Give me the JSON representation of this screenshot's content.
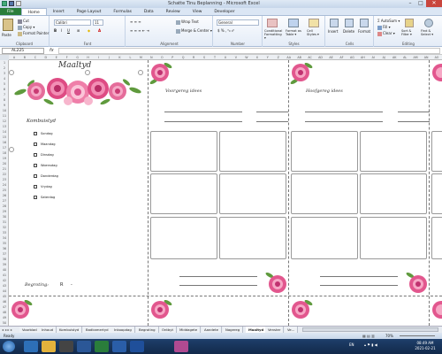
{
  "window": {
    "title": "Schatte Tinu Beplanning  -  Microsoft Excel"
  },
  "tabs": [
    "File",
    "Home",
    "Insert",
    "Page Layout",
    "Formulas",
    "Data",
    "Review",
    "View",
    "Developer"
  ],
  "ribbon": {
    "clipboard": {
      "paste": "Paste",
      "cut": "Cut",
      "copy": "Copy ▾",
      "format_painter": "Format Painter",
      "label": "Clipboard"
    },
    "font": {
      "name": "Calibri",
      "size": "11",
      "label": "Font"
    },
    "alignment": {
      "wrap": "Wrap Text",
      "merge": "Merge & Center ▾",
      "label": "Alignment"
    },
    "number": {
      "format": "General",
      "label": "Number"
    },
    "styles": {
      "conditional": "Conditional Formatting ▾",
      "format_table": "Format as Table ▾",
      "cell_styles": "Cell Styles ▾",
      "label": "Styles"
    },
    "cells": {
      "insert": "Insert",
      "delete": "Delete",
      "format": "Format",
      "label": "Cells"
    },
    "editing": {
      "autosum": "AutoSum ▾",
      "fill": "Fill ▾",
      "clear": "Clear ▾",
      "sort": "Sort & Filter ▾",
      "find": "Find & Select ▾",
      "label": "Editing"
    }
  },
  "formula_bar": {
    "name_box": "AL225",
    "fx": "fx"
  },
  "columns": [
    "A",
    "B",
    "C",
    "D",
    "E",
    "F",
    "G",
    "H",
    "I",
    "J",
    "K",
    "L",
    "M",
    "N",
    "O",
    "P",
    "Q",
    "R",
    "S",
    "T",
    "U",
    "V",
    "W",
    "X",
    "Y",
    "Z",
    "AA",
    "AB",
    "AC",
    "AD",
    "AE",
    "AF",
    "AG",
    "AH",
    "AI",
    "AJ",
    "AK",
    "AL",
    "AM",
    "AN",
    "AO"
  ],
  "rows": [
    "1",
    "2",
    "3",
    "4",
    "5",
    "6",
    "7",
    "8",
    "9",
    "10",
    "11",
    "12",
    "13",
    "14",
    "15",
    "16",
    "17",
    "18",
    "19",
    "20",
    "21",
    "22",
    "23",
    "24",
    "25",
    "26",
    "27",
    "28",
    "29",
    "30",
    "31",
    "32",
    "33",
    "34",
    "35",
    "36",
    "37",
    "38",
    "39",
    "40",
    "41",
    "42",
    "43",
    "44",
    "45",
    "46",
    "47",
    "48",
    "49",
    "50"
  ],
  "page": {
    "title": "Maaltyd",
    "kombuis_heading": "Kombuistyd",
    "days": [
      "Sondag",
      "Maandag",
      "Dinsdag",
      "Woensdag",
      "Donderdag",
      "Vrydag",
      "Saterdag"
    ],
    "budget_label": "Begroting:",
    "budget_currency": "R",
    "budget_value": "-",
    "voorgereg_heading": "Voorgereg idees",
    "hoofgereg_heading": "Hoofgereg idees"
  },
  "sheet_tabs": [
    "Voorblad",
    "Inhoud",
    "Kombuistyd",
    "Badkamertyd",
    "Inkoopdag",
    "Begroting",
    "Ontbyt",
    "Middagete",
    "Aandete",
    "Nagereg",
    "Maaltyd",
    "Venster",
    "Ve…"
  ],
  "status": {
    "ready": "Ready",
    "zoom": "70%"
  },
  "clock": {
    "time": "08:49 AM",
    "date": "2021-02-21",
    "lang": "EN"
  },
  "colors": {
    "excel_green": "#2a7d3b",
    "rose_pink": "#e0457d",
    "rose_light": "#f7a7c4",
    "leaf": "#5f9a3d"
  }
}
